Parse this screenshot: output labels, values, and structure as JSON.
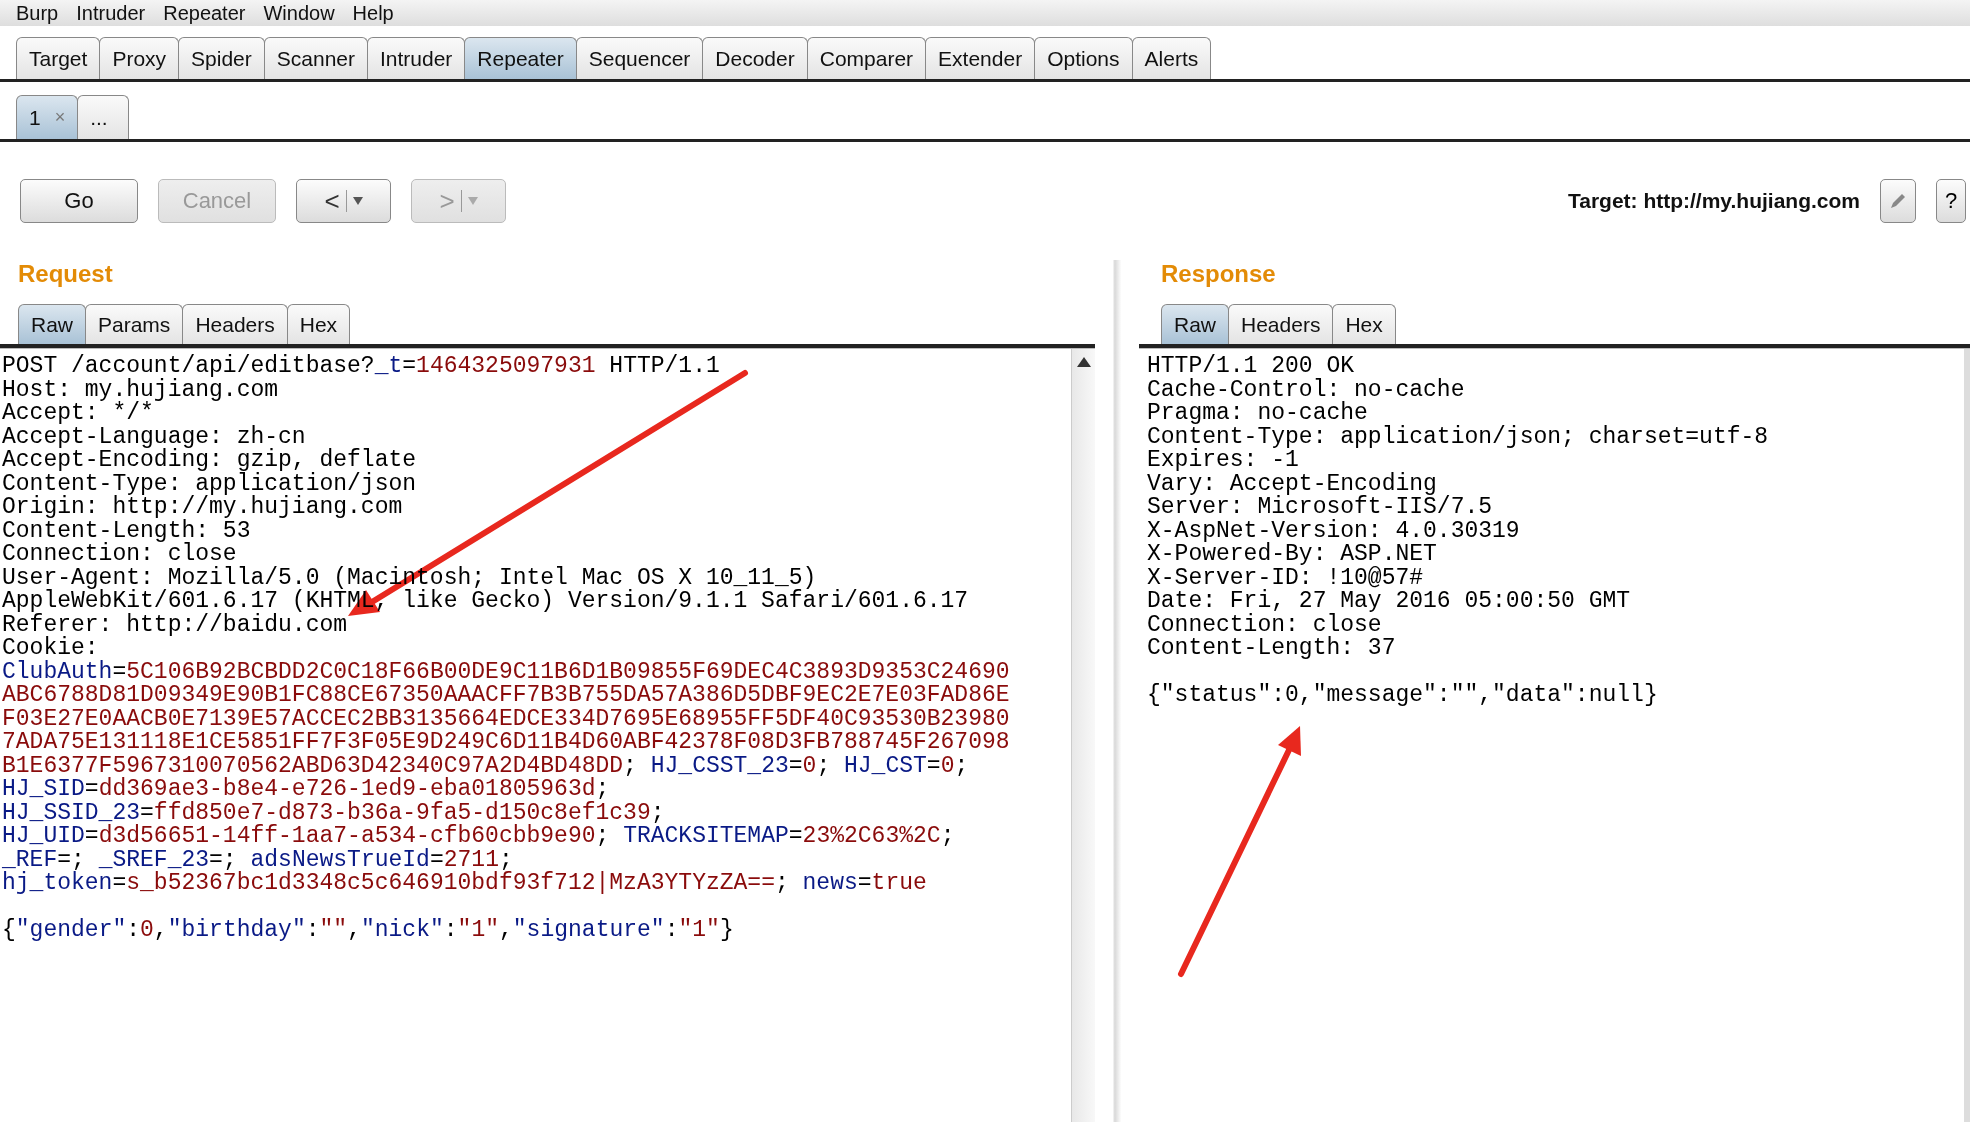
{
  "menu_bar": [
    "Burp",
    "Intruder",
    "Repeater",
    "Window",
    "Help"
  ],
  "main_tabs": [
    {
      "label": "Target",
      "selected": false
    },
    {
      "label": "Proxy",
      "selected": false
    },
    {
      "label": "Spider",
      "selected": false
    },
    {
      "label": "Scanner",
      "selected": false
    },
    {
      "label": "Intruder",
      "selected": false
    },
    {
      "label": "Repeater",
      "selected": true
    },
    {
      "label": "Sequencer",
      "selected": false
    },
    {
      "label": "Decoder",
      "selected": false
    },
    {
      "label": "Comparer",
      "selected": false
    },
    {
      "label": "Extender",
      "selected": false
    },
    {
      "label": "Options",
      "selected": false
    },
    {
      "label": "Alerts",
      "selected": false
    }
  ],
  "repeater_tabs": [
    {
      "label": "1",
      "close": "×",
      "selected": true
    },
    {
      "label": "...",
      "selected": false
    }
  ],
  "toolbar": {
    "buttons": [
      {
        "kind": "text",
        "label": "Go",
        "disabled": false
      },
      {
        "kind": "text",
        "label": "Cancel",
        "disabled": true
      },
      {
        "kind": "back",
        "label": "<",
        "disabled": false
      },
      {
        "kind": "forward",
        "label": ">",
        "disabled": true
      }
    ],
    "target_label": "Target: http://my.hujiang.com",
    "help_button": "?"
  },
  "request": {
    "title": "Request",
    "tabs": [
      {
        "label": "Raw",
        "selected": true
      },
      {
        "label": "Params",
        "selected": false
      },
      {
        "label": "Headers",
        "selected": false
      },
      {
        "label": "Hex",
        "selected": false
      }
    ],
    "lines": [
      [
        {
          "text": "POST /account/api/editbase?",
          "kind": "plain"
        },
        {
          "text": "_t",
          "kind": "name"
        },
        {
          "text": "=",
          "kind": "plain"
        },
        {
          "text": "1464325097931",
          "kind": "value"
        },
        {
          "text": " HTTP/1.1",
          "kind": "plain"
        }
      ],
      [
        {
          "text": "Host: my.hujiang.com",
          "kind": "plain"
        }
      ],
      [
        {
          "text": "Accept: */*",
          "kind": "plain"
        }
      ],
      [
        {
          "text": "Accept-Language: zh-cn",
          "kind": "plain"
        }
      ],
      [
        {
          "text": "Accept-Encoding: gzip, deflate",
          "kind": "plain"
        }
      ],
      [
        {
          "text": "Content-Type: application/json",
          "kind": "plain"
        }
      ],
      [
        {
          "text": "Origin: http://my.hujiang.com",
          "kind": "plain"
        }
      ],
      [
        {
          "text": "Content-Length: 53",
          "kind": "plain"
        }
      ],
      [
        {
          "text": "Connection: close",
          "kind": "plain"
        }
      ],
      [
        {
          "text": "User-Agent: Mozilla/5.0 (Macintosh; Intel Mac OS X 10_11_5)",
          "kind": "plain"
        }
      ],
      [
        {
          "text": "AppleWebKit/601.6.17 (KHTML, like Gecko) Version/9.1.1 Safari/601.6.17",
          "kind": "plain"
        }
      ],
      [
        {
          "text": "Referer: http://baidu.com",
          "kind": "plain"
        }
      ],
      [
        {
          "text": "Cookie:",
          "kind": "plain"
        }
      ],
      [
        {
          "text": "ClubAuth",
          "kind": "name"
        },
        {
          "text": "=",
          "kind": "plain"
        },
        {
          "text": "5C106B92BCBDD2C0C18F66B00DE9C11B6D1B09855F69DEC4C3893D9353C24690",
          "kind": "value"
        }
      ],
      [
        {
          "text": "ABC6788D81D09349E90B1FC88CE67350AAACFF7B3B755DA57A386D5DBF9EC2E7E03FAD86E",
          "kind": "value"
        }
      ],
      [
        {
          "text": "F03E27E0AACB0E7139E57ACCEC2BB3135664EDCE334D7695E68955FF5DF40C93530B23980",
          "kind": "value"
        }
      ],
      [
        {
          "text": "7ADA75E131118E1CE5851FF7F3F05E9D249C6D11B4D60ABF42378F08D3FB788745F267098",
          "kind": "value"
        }
      ],
      [
        {
          "text": "B1E6377F5967310070562ABD63D42340C97A2D4BD48DD",
          "kind": "value"
        },
        {
          "text": "; ",
          "kind": "plain"
        },
        {
          "text": "HJ_CSST_23",
          "kind": "name"
        },
        {
          "text": "=",
          "kind": "plain"
        },
        {
          "text": "0",
          "kind": "value"
        },
        {
          "text": "; ",
          "kind": "plain"
        },
        {
          "text": "HJ_CST",
          "kind": "name"
        },
        {
          "text": "=",
          "kind": "plain"
        },
        {
          "text": "0",
          "kind": "value"
        },
        {
          "text": ";",
          "kind": "plain"
        }
      ],
      [
        {
          "text": "HJ_SID",
          "kind": "name"
        },
        {
          "text": "=",
          "kind": "plain"
        },
        {
          "text": "dd369ae3-b8e4-e726-1ed9-eba01805963d",
          "kind": "value"
        },
        {
          "text": ";",
          "kind": "plain"
        }
      ],
      [
        {
          "text": "HJ_SSID_23",
          "kind": "name"
        },
        {
          "text": "=",
          "kind": "plain"
        },
        {
          "text": "ffd850e7-d873-b36a-9fa5-d150c8ef1c39",
          "kind": "value"
        },
        {
          "text": ";",
          "kind": "plain"
        }
      ],
      [
        {
          "text": "HJ_UID",
          "kind": "name"
        },
        {
          "text": "=",
          "kind": "plain"
        },
        {
          "text": "d3d56651-14ff-1aa7-a534-cfb60cbb9e90",
          "kind": "value"
        },
        {
          "text": "; ",
          "kind": "plain"
        },
        {
          "text": "TRACKSITEMAP",
          "kind": "name"
        },
        {
          "text": "=",
          "kind": "plain"
        },
        {
          "text": "23%2C63%2C",
          "kind": "value"
        },
        {
          "text": ";",
          "kind": "plain"
        }
      ],
      [
        {
          "text": "_REF",
          "kind": "name"
        },
        {
          "text": "=; ",
          "kind": "plain"
        },
        {
          "text": "_SREF_23",
          "kind": "name"
        },
        {
          "text": "=; ",
          "kind": "plain"
        },
        {
          "text": "adsNewsTrueId",
          "kind": "name"
        },
        {
          "text": "=",
          "kind": "plain"
        },
        {
          "text": "2711",
          "kind": "value"
        },
        {
          "text": ";",
          "kind": "plain"
        }
      ],
      [
        {
          "text": "hj_token",
          "kind": "name"
        },
        {
          "text": "=",
          "kind": "plain"
        },
        {
          "text": "s_b52367bc1d3348c5c646910bdf93f712|MzA3YTYzZA==",
          "kind": "value"
        },
        {
          "text": "; ",
          "kind": "plain"
        },
        {
          "text": "news",
          "kind": "name"
        },
        {
          "text": "=",
          "kind": "plain"
        },
        {
          "text": "true",
          "kind": "value"
        }
      ]
    ],
    "body": [
      {
        "text": "{",
        "kind": "plain"
      },
      {
        "text": "\"gender\"",
        "kind": "name"
      },
      {
        "text": ":",
        "kind": "plain"
      },
      {
        "text": "0",
        "kind": "value"
      },
      {
        "text": ",",
        "kind": "plain"
      },
      {
        "text": "\"birthday\"",
        "kind": "name"
      },
      {
        "text": ":",
        "kind": "plain"
      },
      {
        "text": "\"\"",
        "kind": "value"
      },
      {
        "text": ",",
        "kind": "plain"
      },
      {
        "text": "\"nick\"",
        "kind": "name"
      },
      {
        "text": ":",
        "kind": "plain"
      },
      {
        "text": "\"1\"",
        "kind": "value"
      },
      {
        "text": ",",
        "kind": "plain"
      },
      {
        "text": "\"signature\"",
        "kind": "name"
      },
      {
        "text": ":",
        "kind": "plain"
      },
      {
        "text": "\"1\"",
        "kind": "value"
      },
      {
        "text": "}",
        "kind": "plain"
      }
    ]
  },
  "response": {
    "title": "Response",
    "tabs": [
      {
        "label": "Raw",
        "selected": true
      },
      {
        "label": "Headers",
        "selected": false
      },
      {
        "label": "Hex",
        "selected": false
      }
    ],
    "lines": [
      "HTTP/1.1 200 OK",
      "Cache-Control: no-cache",
      "Pragma: no-cache",
      "Content-Type: application/json; charset=utf-8",
      "Expires: -1",
      "Vary: Accept-Encoding",
      "Server: Microsoft-IIS/7.5",
      "X-AspNet-Version: 4.0.30319",
      "X-Powered-By: ASP.NET",
      "X-Server-ID: !10@57#",
      "Date: Fri, 27 May 2016 05:00:50 GMT",
      "Connection: close",
      "Content-Length: 37"
    ],
    "body": "{\"status\":0,\"message\":\"\",\"data\":null}"
  }
}
